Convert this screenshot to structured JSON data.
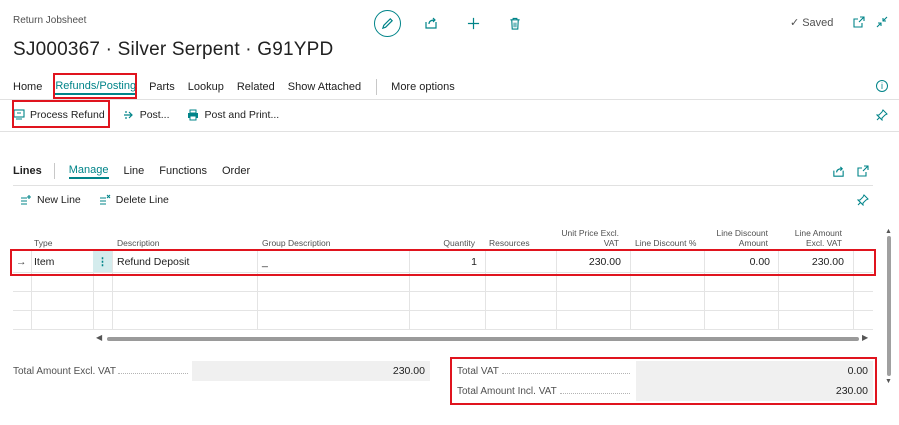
{
  "header": {
    "breadcrumb": "Return Jobsheet",
    "title": "SJ000367 · Silver Serpent · G91YPD",
    "saved_label": "Saved"
  },
  "nav": {
    "tabs": [
      "Home",
      "Refunds/Posting",
      "Parts",
      "Lookup",
      "Related",
      "Show Attached"
    ],
    "active": "Refunds/Posting",
    "more": "More options"
  },
  "actions": {
    "process_refund": "Process Refund",
    "post": "Post...",
    "post_and_print": "Post and Print..."
  },
  "lines": {
    "label": "Lines",
    "tabs": [
      "Manage",
      "Line",
      "Functions",
      "Order"
    ],
    "active": "Manage",
    "new_line": "New Line",
    "delete_line": "Delete Line",
    "columns": {
      "type": "Type",
      "description": "Description",
      "group_description": "Group Description",
      "quantity": "Quantity",
      "resources": "Resources",
      "unit_price_1": "Unit Price Excl.",
      "unit_price_2": "VAT",
      "line_discount_pct": "Line Discount %",
      "line_discount_amount_1": "Line Discount",
      "line_discount_amount_2": "Amount",
      "line_amount_1": "Line Amount",
      "line_amount_2": "Excl. VAT"
    },
    "rows": [
      {
        "type": "Item",
        "description": "Refund Deposit",
        "group_description": "_",
        "quantity": "1",
        "resources": "",
        "unit_price": "230.00",
        "line_discount_pct": "",
        "line_discount_amount": "0.00",
        "line_amount": "230.00"
      }
    ]
  },
  "totals": {
    "excl_vat_label": "Total Amount Excl. VAT",
    "excl_vat_value": "230.00",
    "vat_label": "Total VAT",
    "vat_value": "0.00",
    "incl_vat_label": "Total Amount Incl. VAT",
    "incl_vat_value": "230.00"
  },
  "colors": {
    "accent": "#008489",
    "highlight": "#e0141e"
  }
}
